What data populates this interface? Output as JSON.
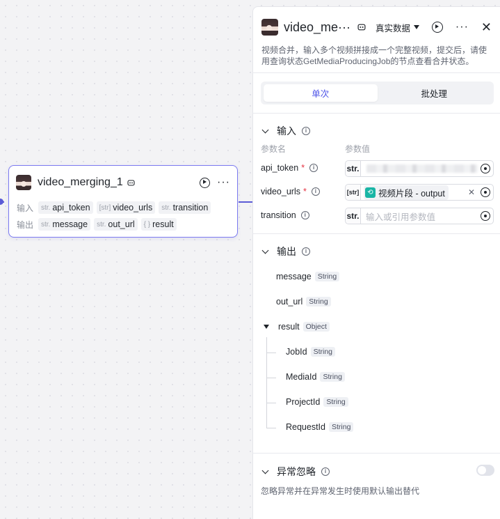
{
  "node": {
    "title": "video_merging_1",
    "inputs_label": "输入",
    "outputs_label": "输出",
    "inputs": [
      {
        "type": "str.",
        "name": "api_token"
      },
      {
        "type": "[str]",
        "name": "video_urls"
      },
      {
        "type": "str.",
        "name": "transition"
      }
    ],
    "outputs": [
      {
        "type": "str.",
        "name": "message"
      },
      {
        "type": "str.",
        "name": "out_url"
      },
      {
        "type": "{ }",
        "name": "result"
      }
    ]
  },
  "panel": {
    "title": "video_me···",
    "mode_label": "真实数据",
    "description": "视频合并，输入多个视频拼接成一个完整视频，提交后，请使用查询状态GetMediaProducingJob的节点查看合并状态。",
    "tabs": [
      {
        "label": "单次",
        "active": true
      },
      {
        "label": "批处理",
        "active": false
      }
    ],
    "input_section": {
      "title": "输入",
      "col_param_name": "参数名",
      "col_param_value": "参数值",
      "params": [
        {
          "name": "api_token",
          "required": true,
          "type": "str.",
          "value": ""
        },
        {
          "name": "video_urls",
          "required": true,
          "type": "[str]",
          "ref_label": "视频片段 - output"
        },
        {
          "name": "transition",
          "required": false,
          "type": "str.",
          "placeholder": "输入或引用参数值"
        }
      ]
    },
    "output_section": {
      "title": "输出",
      "items": [
        {
          "name": "message",
          "type": "String"
        },
        {
          "name": "out_url",
          "type": "String"
        },
        {
          "name": "result",
          "type": "Object"
        },
        {
          "name": "JobId",
          "type": "String"
        },
        {
          "name": "MediaId",
          "type": "String"
        },
        {
          "name": "ProjectId",
          "type": "String"
        },
        {
          "name": "RequestId",
          "type": "String"
        }
      ]
    },
    "exception_section": {
      "title": "异常忽略",
      "description": "忽略异常并在异常发生时使用默认输出替代",
      "enabled": false
    }
  },
  "colors": {
    "accent": "#4d53e8",
    "node_border": "#7b79f0",
    "edge": "#5b5bd6",
    "required": "#e53241",
    "ref_icon": "#19b5a5"
  },
  "icons": [
    "avatar",
    "bot-icon",
    "play-icon",
    "more-icon",
    "close-icon",
    "chevron-down-icon",
    "info-icon",
    "target-icon",
    "clear-icon",
    "reference-icon",
    "caret-down-icon",
    "tree-toggle-icon",
    "toggle-switch"
  ]
}
